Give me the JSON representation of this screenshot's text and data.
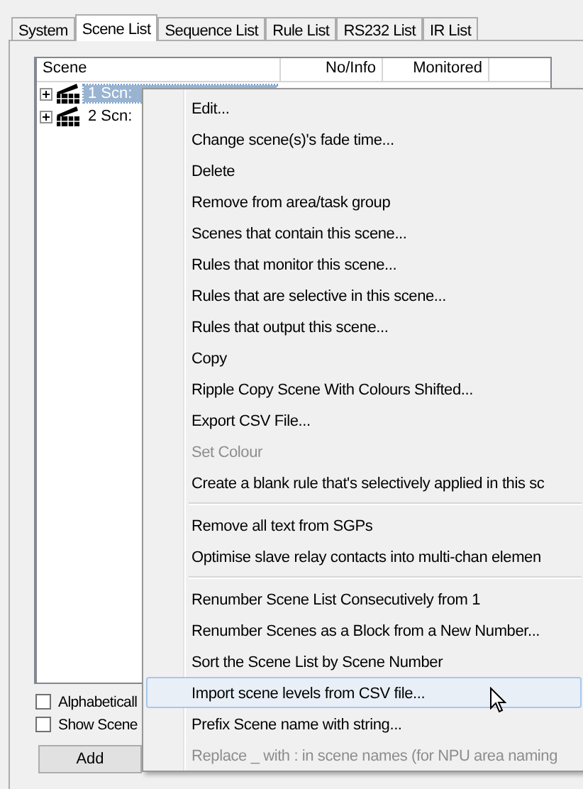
{
  "tabs": [
    {
      "label": "System",
      "selected": false
    },
    {
      "label": "Scene List",
      "selected": true
    },
    {
      "label": "Sequence List",
      "selected": false
    },
    {
      "label": "Rule List",
      "selected": false
    },
    {
      "label": "RS232 List",
      "selected": false
    },
    {
      "label": "IR List",
      "selected": false
    }
  ],
  "scene_list": {
    "columns": [
      "Scene",
      "No/Info",
      "Monitored"
    ],
    "rows": [
      {
        "label": "1 Scn:",
        "selected": true,
        "expanded": false
      },
      {
        "label": "2 Scn:",
        "selected": false,
        "expanded": false
      }
    ]
  },
  "options": [
    {
      "label": "Alphabeticall",
      "checked": false
    },
    {
      "label": "Show Scene",
      "checked": false
    }
  ],
  "buttons": [
    "Add"
  ],
  "context_menu": [
    {
      "kind": "item",
      "label": "Edit...",
      "disabled": false,
      "selected": false
    },
    {
      "kind": "item",
      "label": "Change scene(s)'s fade time...",
      "disabled": false,
      "selected": false
    },
    {
      "kind": "item",
      "label": "Delete",
      "disabled": false,
      "selected": false
    },
    {
      "kind": "item",
      "label": "Remove from area/task group",
      "disabled": false,
      "selected": false
    },
    {
      "kind": "item",
      "label": "Scenes that contain this scene...",
      "disabled": false,
      "selected": false
    },
    {
      "kind": "item",
      "label": "Rules that monitor this scene...",
      "disabled": false,
      "selected": false
    },
    {
      "kind": "item",
      "label": "Rules that are selective in this scene...",
      "disabled": false,
      "selected": false
    },
    {
      "kind": "item",
      "label": "Rules that output this scene...",
      "disabled": false,
      "selected": false
    },
    {
      "kind": "item",
      "label": "Copy",
      "disabled": false,
      "selected": false
    },
    {
      "kind": "item",
      "label": "Ripple Copy Scene With Colours Shifted...",
      "disabled": false,
      "selected": false
    },
    {
      "kind": "item",
      "label": "Export CSV File...",
      "disabled": false,
      "selected": false
    },
    {
      "kind": "item",
      "label": "Set Colour",
      "disabled": true,
      "selected": false
    },
    {
      "kind": "item",
      "label": "Create a blank rule that's selectively applied in this sc",
      "disabled": false,
      "selected": false
    },
    {
      "kind": "separator"
    },
    {
      "kind": "item",
      "label": "Remove all text from SGPs",
      "disabled": false,
      "selected": false
    },
    {
      "kind": "item",
      "label": "Optimise slave relay contacts into multi-chan elemen",
      "disabled": false,
      "selected": false
    },
    {
      "kind": "separator"
    },
    {
      "kind": "item",
      "label": "Renumber Scene List Consecutively from 1",
      "disabled": false,
      "selected": false
    },
    {
      "kind": "item",
      "label": "Renumber Scenes as a Block from a New Number...",
      "disabled": false,
      "selected": false
    },
    {
      "kind": "item",
      "label": "Sort the Scene List by Scene Number",
      "disabled": false,
      "selected": false
    },
    {
      "kind": "item",
      "label": "Import scene levels from CSV file...",
      "disabled": false,
      "selected": true
    },
    {
      "kind": "item",
      "label": "Prefix Scene name with string...",
      "disabled": false,
      "selected": false
    },
    {
      "kind": "item",
      "label": "Replace _ with : in scene names (for NPU area naming",
      "disabled": true,
      "selected": false
    }
  ]
}
